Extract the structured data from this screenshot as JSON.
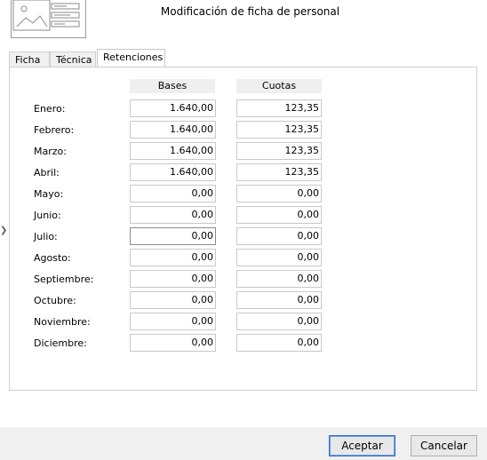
{
  "window": {
    "title": "Modificación de ficha de personal"
  },
  "tabs": [
    {
      "label": "Ficha",
      "active": false
    },
    {
      "label": "Técnica",
      "active": false
    },
    {
      "label": "Retenciones",
      "active": true
    }
  ],
  "columns": {
    "bases": "Bases",
    "cuotas": "Cuotas"
  },
  "rows": [
    {
      "month": "Enero:",
      "base": "1.640,00",
      "cuota": "123,35"
    },
    {
      "month": "Febrero:",
      "base": "1.640,00",
      "cuota": "123,35"
    },
    {
      "month": "Marzo:",
      "base": "1.640,00",
      "cuota": "123,35"
    },
    {
      "month": "Abril:",
      "base": "1.640,00",
      "cuota": "123,35"
    },
    {
      "month": "Mayo:",
      "base": "0,00",
      "cuota": "0,00"
    },
    {
      "month": "Junio:",
      "base": "0,00",
      "cuota": "0,00"
    },
    {
      "month": "Julio:",
      "base": "0,00",
      "cuota": "0,00"
    },
    {
      "month": "Agosto:",
      "base": "0,00",
      "cuota": "0,00"
    },
    {
      "month": "Septiembre:",
      "base": "0,00",
      "cuota": "0,00"
    },
    {
      "month": "Octubre:",
      "base": "0,00",
      "cuota": "0,00"
    },
    {
      "month": "Noviembre:",
      "base": "0,00",
      "cuota": "0,00"
    },
    {
      "month": "Diciembre:",
      "base": "0,00",
      "cuota": "0,00"
    }
  ],
  "buttons": {
    "accept": "Aceptar",
    "cancel": "Cancelar"
  },
  "icons": {
    "header": "id-card-icon",
    "side": "chevron-right-icon"
  }
}
